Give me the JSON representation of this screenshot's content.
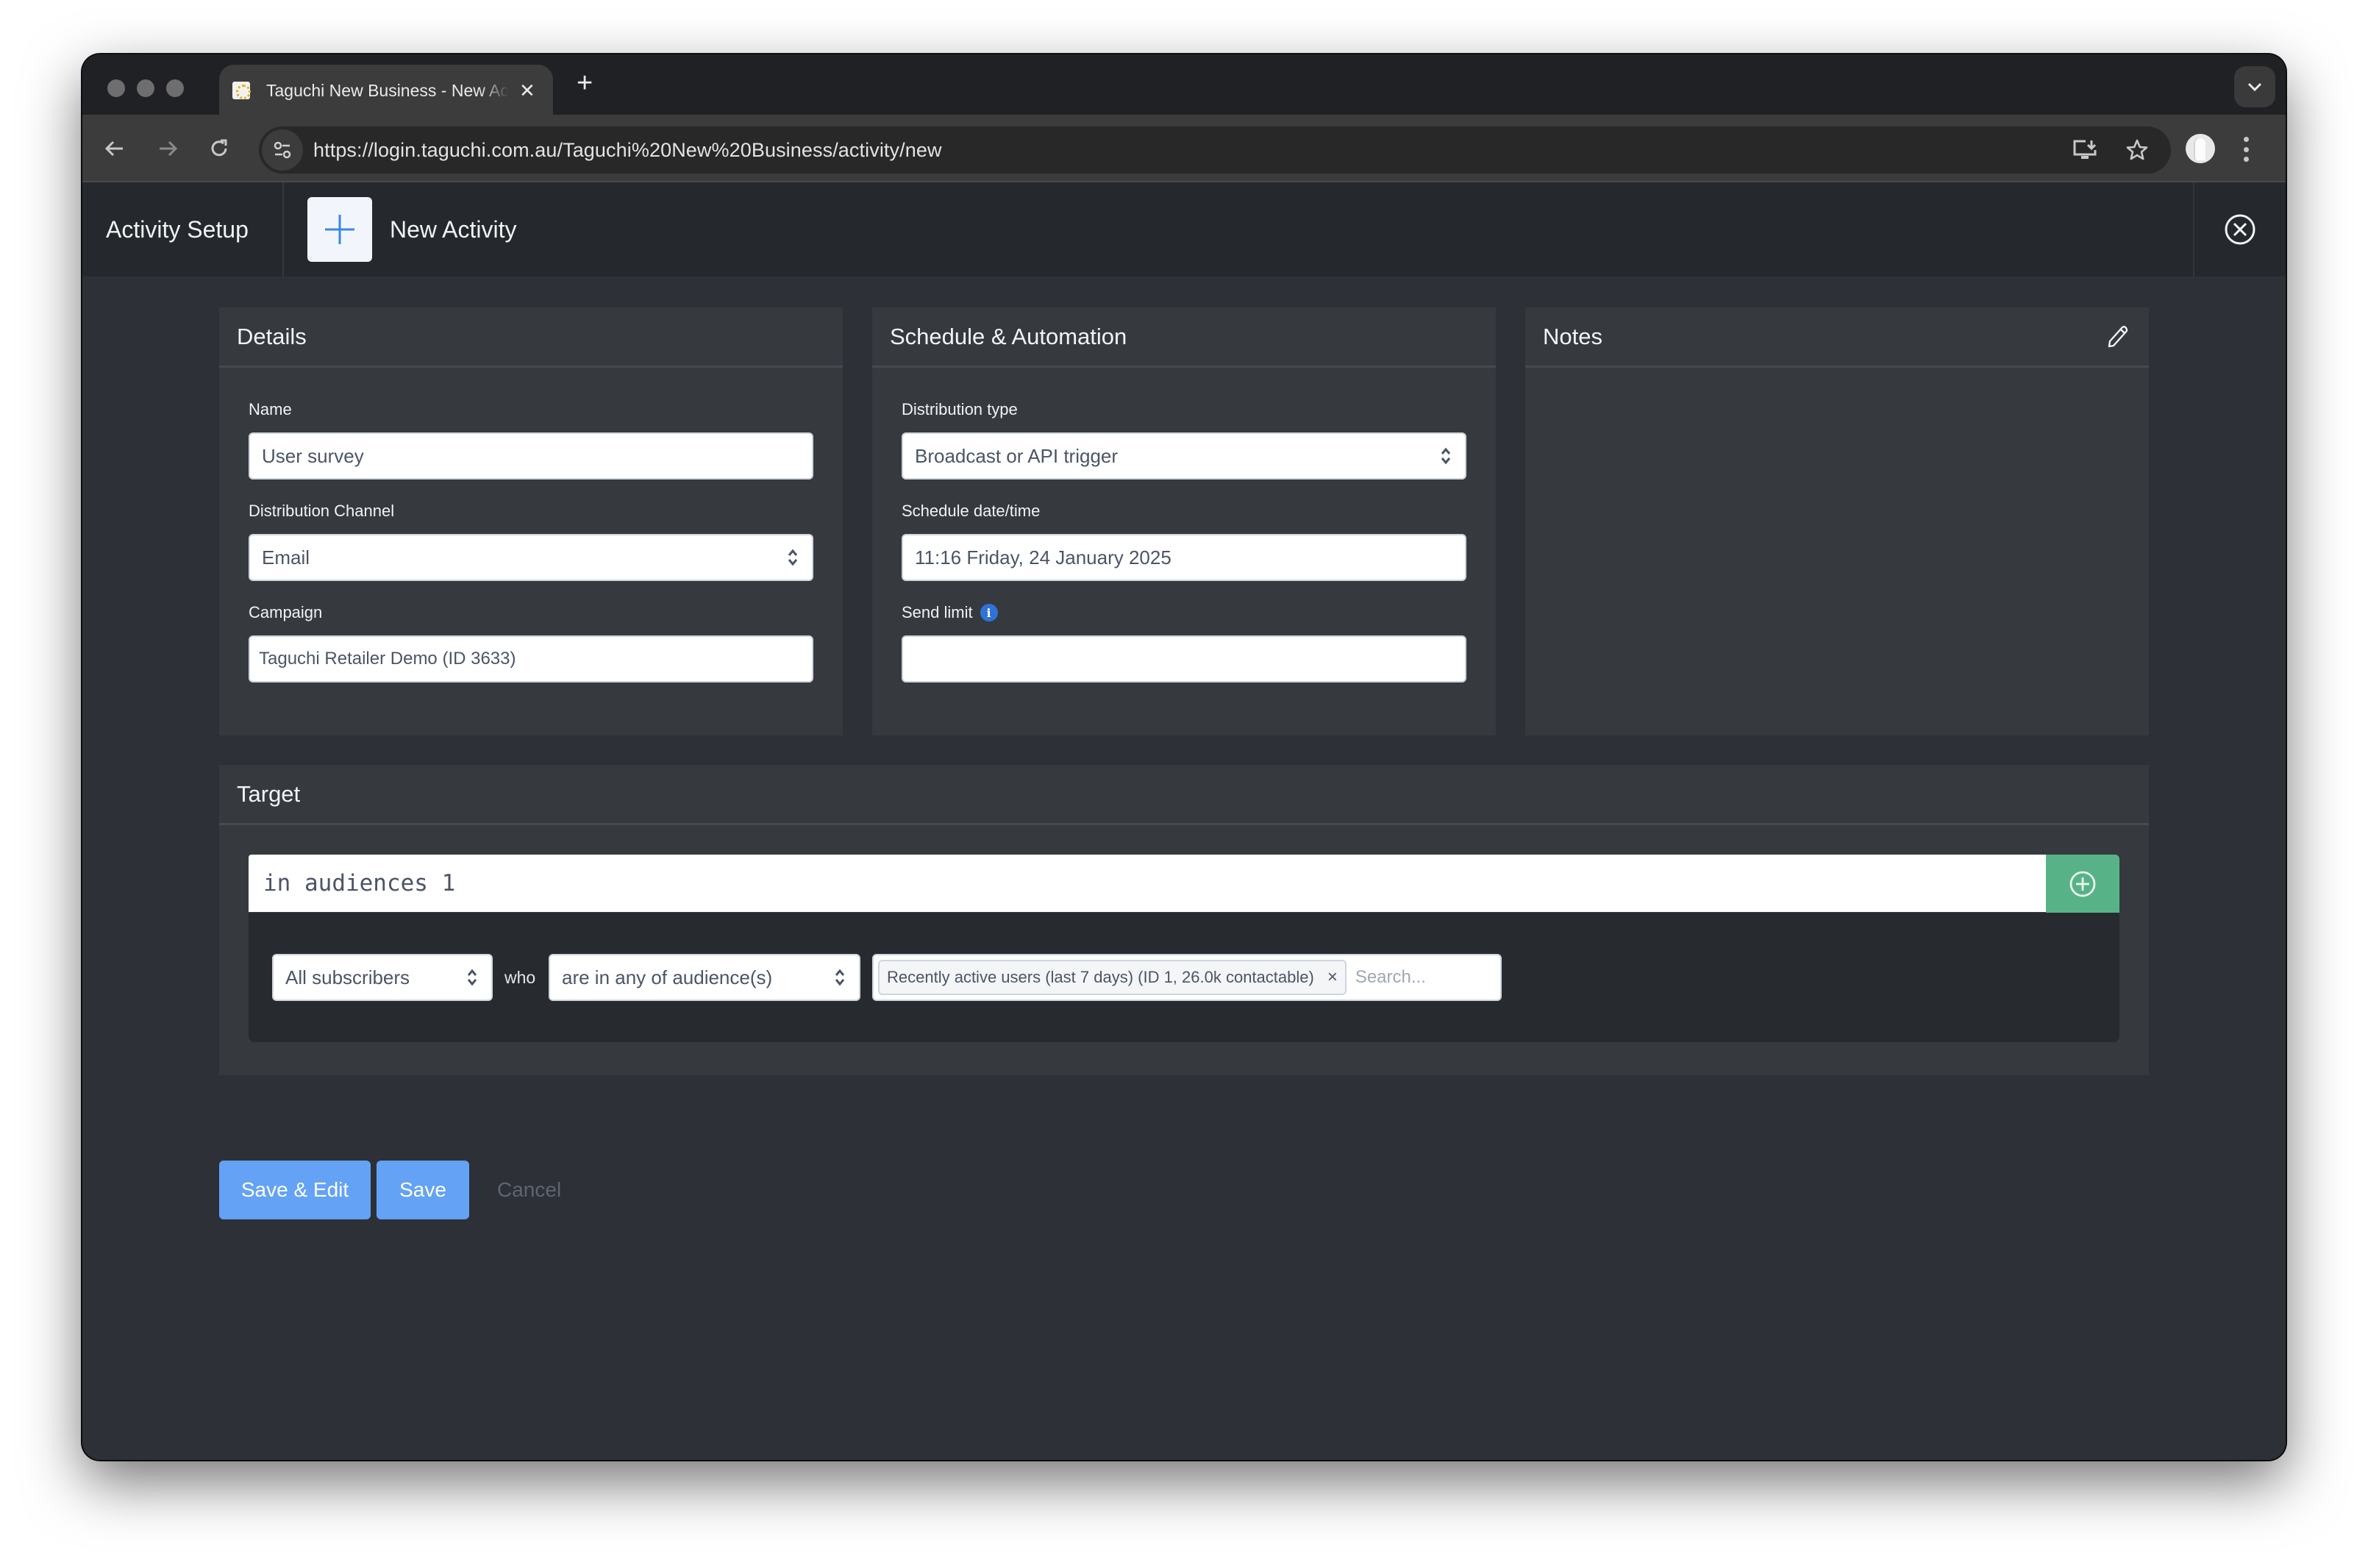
{
  "browser": {
    "tab_title": "Taguchi New Business - New Activity",
    "url": "https://login.taguchi.com.au/Taguchi%20New%20Business/activity/new",
    "icons": {
      "back": "arrow-left-icon",
      "forward": "arrow-right-icon",
      "reload": "reload-icon",
      "site_info": "tune-icon",
      "install": "install-app-icon",
      "bookmark": "star-icon",
      "profile": "avatar",
      "menu": "kebab-icon",
      "tab_search": "chevron-down-icon"
    }
  },
  "header": {
    "section_title": "Activity Setup",
    "page_title": "New Activity",
    "add_icon": "plus-icon",
    "close_icon": "close-circle-icon"
  },
  "details": {
    "title": "Details",
    "name_label": "Name",
    "name_value": "User survey",
    "channel_label": "Distribution Channel",
    "channel_value": "Email",
    "campaign_label": "Campaign",
    "campaign_value": "Taguchi Retailer Demo (ID 3633)"
  },
  "schedule": {
    "title": "Schedule & Automation",
    "type_label": "Distribution type",
    "type_value": "Broadcast or API trigger",
    "datetime_label": "Schedule date/time",
    "datetime_value": "11:16 Friday, 24 January 2025",
    "limit_label": "Send limit",
    "limit_value": "",
    "info_glyph": "i"
  },
  "notes": {
    "title": "Notes",
    "edit_icon": "pencil-icon"
  },
  "target": {
    "title": "Target",
    "query": "in audiences 1",
    "add_icon": "plus-circle-icon",
    "subject_value": "All subscribers",
    "who_label": "who",
    "condition_value": "are in any of audience(s)",
    "chip_label": "Recently active users (last 7 days) (ID 1, 26.0k contactable)",
    "chip_remove": "×",
    "search_placeholder": "Search..."
  },
  "actions": {
    "save_edit_label": "Save & Edit",
    "save_label": "Save",
    "cancel_label": "Cancel"
  },
  "colors": {
    "primary_button": "#64a2f6",
    "add_rule": "#57b387",
    "info_badge": "#2f72d8",
    "page_bg": "#2d3036",
    "panel_bg": "#363a3f"
  }
}
